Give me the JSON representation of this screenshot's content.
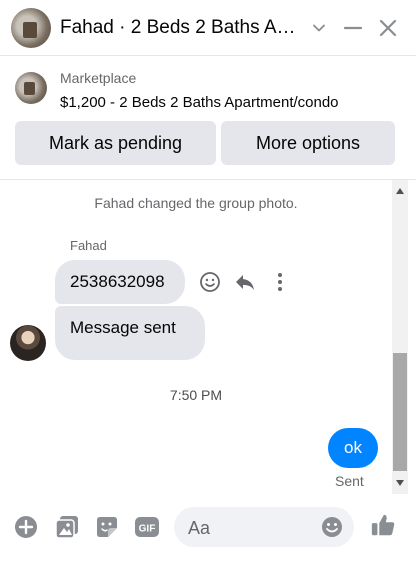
{
  "header": {
    "title": "Fahad · 2 Beds 2 Baths Ap...",
    "icons": [
      "chevron-down-icon",
      "minimize-icon",
      "close-icon"
    ]
  },
  "marketplace": {
    "label": "Marketplace",
    "listing": "$1,200 - 2 Beds 2 Baths Apartment/condo",
    "mark_pending_label": "Mark as pending",
    "more_options_label": "More options"
  },
  "chat": {
    "system_message": "Fahad changed the group photo.",
    "sender_name": "Fahad",
    "messages": [
      {
        "text": "2538632098"
      },
      {
        "text": "Message sent"
      }
    ],
    "timestamp": "7:50 PM",
    "outgoing": {
      "text": "ok",
      "status": "Sent"
    }
  },
  "composer": {
    "placeholder": "Aa",
    "icons": [
      "plus-icon",
      "image-icon",
      "sticker-icon",
      "gif-icon",
      "emoji-icon",
      "thumbs-up-icon"
    ]
  },
  "colors": {
    "accent": "#0084ff",
    "bubble_in": "#e4e6eb",
    "icon": "#8a8d91"
  }
}
